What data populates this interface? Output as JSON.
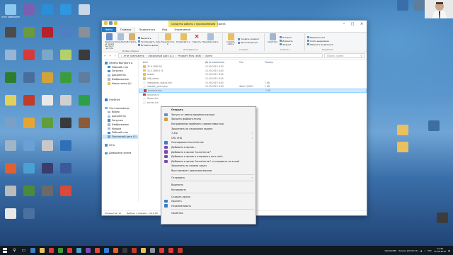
{
  "desktop_icons": [
    {
      "id": "d1",
      "label": "Этот компьютер",
      "color": "#8ec7ef"
    },
    {
      "id": "d2",
      "label": "",
      "color": "#7b5fb0"
    },
    {
      "id": "d3",
      "label": "",
      "color": "#2b8ed6"
    },
    {
      "id": "d4",
      "label": "",
      "color": "#2f96e0"
    },
    {
      "id": "d5",
      "label": "",
      "color": "#c8d8e8"
    },
    {
      "id": "d6",
      "label": "",
      "color": "#4c4c4c"
    },
    {
      "id": "d7",
      "label": "",
      "color": "#6a9a3c"
    },
    {
      "id": "d8",
      "label": "",
      "color": "#b8202a"
    },
    {
      "id": "d9",
      "label": "",
      "color": "#4d7fc2"
    },
    {
      "id": "d10",
      "label": "",
      "color": "#8a8f98"
    },
    {
      "id": "d11",
      "label": "",
      "color": "#98b5d5"
    },
    {
      "id": "d12",
      "label": "",
      "color": "#d83a3a"
    },
    {
      "id": "d13",
      "label": "",
      "color": "#7aa8c6"
    },
    {
      "id": "d14",
      "label": "",
      "color": "#b5d068"
    },
    {
      "id": "d15",
      "label": "",
      "color": "#3b3b3b"
    },
    {
      "id": "d16",
      "label": "",
      "color": "#2e7d2e"
    },
    {
      "id": "d17",
      "label": "",
      "color": "#4a6e9c"
    },
    {
      "id": "d18",
      "label": "",
      "color": "#d4a23a"
    },
    {
      "id": "d19",
      "label": "",
      "color": "#3c9c3c"
    },
    {
      "id": "d20",
      "label": "",
      "color": "#5f7d9d"
    },
    {
      "id": "d21",
      "label": "",
      "color": "#e0d060"
    },
    {
      "id": "d22",
      "label": "",
      "color": "#c23a2a"
    },
    {
      "id": "d23",
      "label": "",
      "color": "#e8e8e8"
    },
    {
      "id": "d24",
      "label": "",
      "color": "#d0d0d0"
    },
    {
      "id": "d25",
      "label": "",
      "color": "#2d9e4a"
    },
    {
      "id": "d26",
      "label": "",
      "color": "#7aa0c8"
    },
    {
      "id": "d27",
      "label": "",
      "color": "#e5a530"
    },
    {
      "id": "d28",
      "label": "",
      "color": "#5f9e3a"
    },
    {
      "id": "d29",
      "label": "",
      "color": "#3a3a3a"
    },
    {
      "id": "d30",
      "label": "",
      "color": "#8a5a3a"
    },
    {
      "id": "d31",
      "label": "",
      "color": "#a0b5c8"
    },
    {
      "id": "d32",
      "label": "",
      "color": "#6aa0d5"
    },
    {
      "id": "d33",
      "label": "",
      "color": "#c8c8c8"
    },
    {
      "id": "d34",
      "label": "",
      "color": "#2e6fb8"
    },
    {
      "id": "d35",
      "label": "",
      "color": "#e06030"
    },
    {
      "id": "d36",
      "label": "",
      "color": "#4aa0d0"
    },
    {
      "id": "d37",
      "label": "",
      "color": "#3c3c6c"
    },
    {
      "id": "d38",
      "label": "",
      "color": "#3a5a9a"
    },
    {
      "id": "d39",
      "label": "",
      "color": "#bbbbbb"
    },
    {
      "id": "d40",
      "label": "",
      "color": "#4a8a3a"
    },
    {
      "id": "d41",
      "label": "",
      "color": "#6a6a6a"
    },
    {
      "id": "d42",
      "label": "",
      "color": "#d84a3a"
    },
    {
      "id": "d43",
      "label": "",
      "color": "#e8e8e8"
    },
    {
      "id": "d44",
      "label": "",
      "color": "#4a70a0"
    },
    {
      "id": "r1",
      "label": "",
      "color": "#3a6ea8"
    },
    {
      "id": "r2",
      "label": "",
      "color": "#5f7d9d"
    },
    {
      "id": "r3",
      "label": "",
      "color": "#e8c060"
    },
    {
      "id": "r4",
      "label": "",
      "color": "#e8c060"
    },
    {
      "id": "r5",
      "label": "",
      "color": "#3c3c3c"
    },
    {
      "id": "r6",
      "label": "",
      "color": "#3e6ea0"
    }
  ],
  "explorer": {
    "title": "Opera",
    "context_tab": "Средства работы с приложениями",
    "tabs": [
      "Файл",
      "Главная",
      "Поделиться",
      "Вид",
      "Управление"
    ],
    "ribbon": {
      "clipboard": {
        "name": "Буфер обмена",
        "pin": "Закрепить на панели быстрого доступа",
        "copy": "Копировать",
        "paste": "Вставить",
        "cut": "Вырезать",
        "copy_path": "Скопировать путь",
        "paste_shortcut": "Вставить ярлык"
      },
      "organize": {
        "name": "Упорядочить",
        "move": "Переместить в",
        "copyto": "Копировать в",
        "delete": "Удалить",
        "rename": "Переименовать"
      },
      "new": {
        "name": "Создать",
        "new_folder": "Создать папку",
        "new_item": "Создать элемент",
        "easy_access": "Простой доступ"
      },
      "open": {
        "name": "Открыть",
        "properties": "Свойства",
        "open": "Открыть",
        "edit": "Изменить",
        "history": "Журнал"
      },
      "select": {
        "name": "Выделить",
        "all": "Выделить все",
        "none": "Снять выделение",
        "invert": "Обратить выделение"
      }
    },
    "address": [
      "Этот компьютер",
      "Локальный диск (C:)",
      "Program Files (x86)",
      "Opera"
    ],
    "search_placeholder": "Поиск: Opera",
    "nav": [
      {
        "label": "Панель быстрого д",
        "sub": false,
        "color": "#3b8ee0"
      },
      {
        "label": "Рабочий стол",
        "sub": true,
        "color": "#3b8ee0"
      },
      {
        "label": "Загрузки",
        "sub": true,
        "color": "#3b8ee0"
      },
      {
        "label": "Документы",
        "sub": true,
        "color": "#aab8c8"
      },
      {
        "label": "Изображения",
        "sub": true,
        "color": "#aab8c8"
      },
      {
        "label": "Новая папка (4)",
        "sub": true,
        "color": "#e8c060"
      },
      {
        "label": "",
        "sub": true,
        "color": "#e8c060"
      },
      {
        "label": "",
        "sub": true,
        "color": "#e8c060"
      },
      {
        "label": "",
        "sub": true,
        "color": "#e8c060"
      },
      {
        "label": "OneDrive",
        "sub": false,
        "color": "#2e7fd8"
      },
      {
        "label": "",
        "sub": false,
        "color": "#fff"
      },
      {
        "label": "Этот компьютер",
        "sub": false,
        "color": "#7db3e0"
      },
      {
        "label": "Видео",
        "sub": true,
        "color": "#aab8c8"
      },
      {
        "label": "Документы",
        "sub": true,
        "color": "#aab8c8"
      },
      {
        "label": "Загрузки",
        "sub": true,
        "color": "#3b8ee0"
      },
      {
        "label": "Изображения",
        "sub": true,
        "color": "#aab8c8"
      },
      {
        "label": "Музыка",
        "sub": true,
        "color": "#aab8c8"
      },
      {
        "label": "Рабочий стол",
        "sub": true,
        "color": "#3b8ee0"
      },
      {
        "label": "Локальный диск (C:)",
        "sub": true,
        "color": "#8aa0b8",
        "sel": true
      },
      {
        "label": "",
        "sub": false,
        "color": "#fff"
      },
      {
        "label": "Сеть",
        "sub": false,
        "color": "#5f8fc0"
      },
      {
        "label": "",
        "sub": false,
        "color": "#fff"
      },
      {
        "label": "Домашняя группа",
        "sub": false,
        "color": "#4aa0d0"
      }
    ],
    "columns": [
      "Имя",
      "Дата изменения",
      "Тип",
      "Размер"
    ],
    "files": [
      {
        "name": "31.0.1889.99",
        "date": "12.09.2015 8:23",
        "type": "",
        "size": "",
        "color": "#e8c060"
      },
      {
        "name": "31.0.1889.174",
        "date": "12.09.2015 8:43",
        "type": "",
        "size": "",
        "color": "#e8c060"
      },
      {
        "name": "Assets",
        "date": "12.09.2015 8:43",
        "type": "",
        "size": "",
        "color": "#e8c060"
      },
      {
        "name": "x86_status",
        "date": "12.09.2015 8:43",
        "type": "",
        "size": "",
        "color": "#e8c060"
      },
      {
        "name": "installation_status.xml",
        "date": "12.09.2015 8:43",
        "type": "",
        "size": "1 КБ",
        "color": "#f0f0f0"
      },
      {
        "name": "installer_prefs.json",
        "date": "12.09.2015 8:43",
        "type": "Файл \"JSON\"",
        "size": "1 КБ",
        "color": "#f0f0f0"
      },
      {
        "name": "launcher.exe",
        "date": "",
        "type": "",
        "size": "1 КБ",
        "color": "#d83a3a",
        "sel": true
      },
      {
        "name": "launcher.vi",
        "date": "",
        "type": "",
        "size": "",
        "color": "#d83a3a"
      },
      {
        "name": "Resources",
        "date": "",
        "type": "",
        "size": "",
        "color": "#f0f0f0"
      },
      {
        "name": "server_tra",
        "date": "",
        "type": "",
        "size": "",
        "color": "#f0f0f0"
      }
    ],
    "status": {
      "count": "Элементов: 10",
      "selected": "Выбран 1 элемент: 1019 КБ"
    }
  },
  "context_menu": [
    {
      "label": "Открыть",
      "bold": true
    },
    {
      "label": "Запуск от имени администратора",
      "icon": "#5f8fd0"
    },
    {
      "label": "Запрета файлинглтона",
      "icon": "#d0a040"
    },
    {
      "label": "Исправление проблем с совместимостью"
    },
    {
      "label": "Закрепить на начальном экране"
    },
    {
      "label": "7-Zip",
      "arrow": true
    },
    {
      "label": "CRC SHA",
      "arrow": true
    },
    {
      "label": "Сканировать launcher.exe",
      "icon": "#3a7ec8"
    },
    {
      "label": "Добавить в архив...",
      "icon": "#7a4ab0"
    },
    {
      "label": "Добавить в архив \"launcher.rar\"",
      "icon": "#7a4ab0"
    },
    {
      "label": "Добавить в архив и отправить по e-mail...",
      "icon": "#7a4ab0"
    },
    {
      "label": "Добавить в архив \"launcher.rar\" и отправить по e-mail",
      "icon": "#7a4ab0"
    },
    {
      "label": "Закрепить на панели задач"
    },
    {
      "label": "Восстановить прежнюю версию"
    },
    {
      "sep": true
    },
    {
      "label": "Отправить",
      "arrow": true
    },
    {
      "sep": true
    },
    {
      "label": "Вырезать"
    },
    {
      "label": "Копировать"
    },
    {
      "sep": true
    },
    {
      "label": "Создать ярлык"
    },
    {
      "label": "Удалить",
      "icon": "#3a7ec8"
    },
    {
      "label": "Переименовать",
      "icon": "#3a7ec8"
    },
    {
      "sep": true
    },
    {
      "label": "Свойства"
    }
  ],
  "taskbar": {
    "apps": [
      "#3a7ec8",
      "#e8c060",
      "#d83a3a",
      "#3c9c3c",
      "#d83a3a",
      "#4aa0d0",
      "#7a4ab0",
      "#d84a3a",
      "#2e7fd8",
      "#e06030",
      "#3a3a3a",
      "#c23a2a",
      "#e8c060",
      "#8a8f98",
      "#d83a3a",
      "#d83a3a",
      "#c23a2a"
    ],
    "resolution": "1920x1080",
    "record": "Запись [00:02:11]",
    "lang": "РУС",
    "time": "11:36",
    "date": "12.09.2015"
  }
}
